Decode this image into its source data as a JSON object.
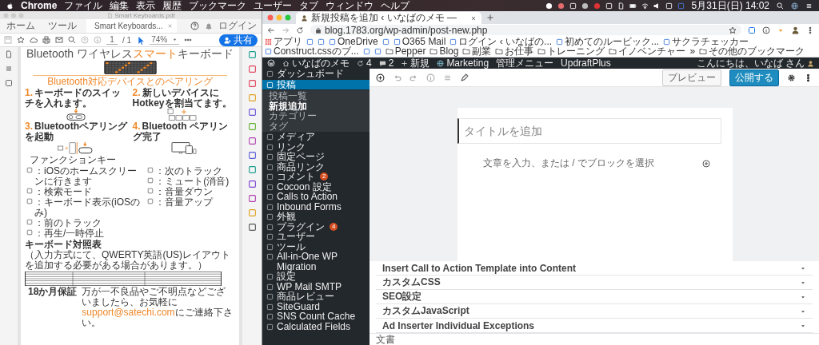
{
  "menu_bar": {
    "app": "Chrome",
    "menus": [
      "ファイル",
      "編集",
      "表示",
      "履歴",
      "ブックマーク",
      "ユーザー",
      "タブ",
      "ウィンドウ",
      "ヘルプ"
    ],
    "clock": "5月31日(日) 14:02"
  },
  "pdf_window": {
    "title": "Smart Keyboards.pdf",
    "tabs": [
      {
        "label": "ホーム",
        "selected": false
      },
      {
        "label": "ツール",
        "selected": false
      },
      {
        "label": "Smart Keyboards...",
        "selected": true
      }
    ],
    "login": "ログイン",
    "page_current": "1",
    "page_total": "/ 1",
    "zoom": "74%",
    "share_button": "共有",
    "document": {
      "title_parts": [
        {
          "text": "Bluetooth ワイヤレス",
          "accent": false
        },
        {
          "text": "スマート",
          "accent": true
        },
        {
          "text": "キーボード",
          "accent": false
        }
      ],
      "section_heading": "Bluetooth対応デバイスとのペアリング",
      "steps": [
        {
          "number": "1.",
          "title": "キーボードのスイッチを入れます。",
          "kind": "switch"
        },
        {
          "number": "2.",
          "title": "新しいデバイスにHotkeyを割当てます。",
          "kind": "hotkeys"
        },
        {
          "number": "3.",
          "title": "Bluetoothペアリングを起動",
          "kind": "pairing"
        },
        {
          "number": "4.",
          "title": "Bluetooth ペアリング完了",
          "kind": "devices"
        }
      ],
      "function_keys": {
        "heading": "ファンクションキー",
        "columns": [
          [
            "：iOSのホームスクリーンに行きます",
            "：検索モード",
            "：キーボード表示(iOSのみ)",
            "：前のトラック",
            "：再生/一時停止"
          ],
          [
            "：次のトラック",
            "：ミュート(消音)",
            "：音量ダウン",
            "：音量アップ"
          ]
        ]
      },
      "key_table": {
        "heading": "キーボード対照表",
        "note": "（入力方式にて、QWERTY英語(US)レイアウトを追加する必要がある場合があります。）"
      },
      "warranty": {
        "label": "18か月保証",
        "text_before": "万が一不良品やご不明点などございましたら、お気軽に",
        "email": "support@satechi.com",
        "text_after": "にご連絡下さい。"
      }
    }
  },
  "browser": {
    "tab_title": "新規投稿を追加 ‹ いなばのメモ —",
    "url": "blog.1783.org/wp-admin/post-new.php",
    "bookmarks": [
      {
        "kind": "apps",
        "label": "アプリ"
      },
      {
        "kind": "site"
      },
      {
        "kind": "site"
      },
      {
        "kind": "site",
        "label": "OneDrive"
      },
      {
        "kind": "site"
      },
      {
        "kind": "site",
        "label": "O365 Mail"
      },
      {
        "kind": "site",
        "label": "ログイン ‹ いなばの..."
      },
      {
        "kind": "site",
        "label": "初めてのルービック..."
      },
      {
        "kind": "site",
        "label": "サクラチェッカー"
      },
      {
        "kind": "site",
        "label": "Construct.cssのブ..."
      },
      {
        "kind": "site"
      },
      {
        "kind": "site"
      },
      {
        "kind": "folder",
        "label": "Pepper"
      },
      {
        "kind": "folder",
        "label": "Blog"
      },
      {
        "kind": "folder",
        "label": "副業"
      },
      {
        "kind": "folder",
        "label": "お仕事"
      },
      {
        "kind": "folder",
        "label": "トレーニング"
      },
      {
        "kind": "folder",
        "label": "イノベンチャー"
      },
      {
        "kind": "more",
        "label": "»"
      },
      {
        "kind": "folder",
        "label": "その他のブックマーク"
      }
    ]
  },
  "wordpress": {
    "admin_bar": {
      "site": "いなばのメモ",
      "updates": "4",
      "comments": "2",
      "new": "新規",
      "items": [
        "Marketing",
        "管理メニュー",
        "UpdraftPlus"
      ],
      "greeting": "こんにちは、いなば さん"
    },
    "sidebar": [
      {
        "label": "ダッシュボード",
        "selected": false
      },
      {
        "label": "投稿",
        "selected": true,
        "children": [
          {
            "label": "投稿一覧",
            "selected": false
          },
          {
            "label": "新規追加",
            "selected": true
          },
          {
            "label": "カテゴリー",
            "selected": false
          },
          {
            "label": "タグ",
            "selected": false
          }
        ]
      },
      {
        "label": "メディア",
        "selected": false
      },
      {
        "label": "リンク",
        "selected": false
      },
      {
        "label": "固定ページ",
        "selected": false
      },
      {
        "label": "商品リンク",
        "selected": false
      },
      {
        "label": "コメント",
        "selected": false,
        "badge": "2"
      },
      {
        "label": "Cocoon 設定",
        "selected": false
      },
      {
        "label": "Calls to Action",
        "selected": false
      },
      {
        "label": "Inbound Forms",
        "selected": false
      },
      {
        "label": "外観",
        "selected": false
      },
      {
        "label": "プラグイン",
        "selected": false,
        "badge": "4"
      },
      {
        "label": "ユーザー",
        "selected": false
      },
      {
        "label": "ツール",
        "selected": false
      },
      {
        "label": "All-in-One WP Migration",
        "selected": false
      },
      {
        "label": "設定",
        "selected": false
      },
      {
        "label": "WP Mail SMTP",
        "selected": false
      },
      {
        "label": "商品レビュー",
        "selected": false
      },
      {
        "label": "SiteGuard",
        "selected": false
      },
      {
        "label": "SNS Count Cache",
        "selected": false
      },
      {
        "label": "Calculated Fields",
        "selected": false
      }
    ],
    "editor": {
      "preview_button": "プレビュー",
      "publish_button": "公開する",
      "title_field": {
        "placeholder": "タイトルを追加"
      },
      "body_hint": "文章を入力、または / でブロックを選択",
      "meta_boxes": [
        "Insert Call to Action Template into Content",
        "カスタムCSS",
        "SEO設定",
        "カスタムJavaScript",
        "Ad Inserter Individual Exceptions"
      ],
      "footer": "文書"
    }
  }
}
